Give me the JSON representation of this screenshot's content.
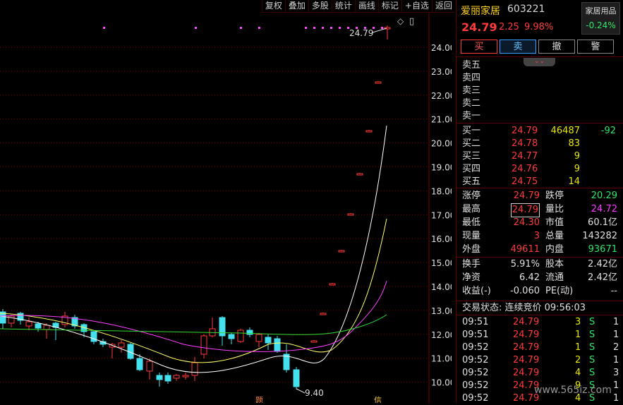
{
  "toolbar": [
    "复权",
    "叠加",
    "多股",
    "统计",
    "画线",
    "标记",
    "+自选",
    "返回"
  ],
  "chart": {
    "y_labels": [
      "24.00",
      "23.00",
      "22.00",
      "21.00",
      "20.00",
      "19.00",
      "18.00",
      "17.00",
      "16.00",
      "15.00",
      "14.00",
      "13.00",
      "12.00",
      "11.00",
      "10.00"
    ],
    "high_label": "24.79",
    "low_label": "9.40",
    "buttons": {
      "diamond": "◇",
      "square": "▯"
    }
  },
  "stock": {
    "name": "爱丽家居",
    "code": "603221",
    "price": "24.79",
    "change": "2.25",
    "pct": "9.98%"
  },
  "sector": {
    "name": "家居用品",
    "pct": "-0.24%"
  },
  "actions": {
    "buy": "买",
    "sell": "卖",
    "cancel": "撤",
    "alert": "警"
  },
  "asks": [
    "卖五",
    "卖四",
    "卖三",
    "卖二",
    "卖一"
  ],
  "bids": [
    {
      "label": "买一",
      "price": "24.79",
      "vol": "46487",
      "delta": "-92"
    },
    {
      "label": "买二",
      "price": "24.78",
      "vol": "83",
      "delta": ""
    },
    {
      "label": "买三",
      "price": "24.77",
      "vol": "9",
      "delta": ""
    },
    {
      "label": "买四",
      "price": "24.76",
      "vol": "9",
      "delta": ""
    },
    {
      "label": "买五",
      "price": "24.75",
      "vol": "14",
      "delta": ""
    }
  ],
  "stats": [
    {
      "l1": "涨停",
      "v1": "24.79",
      "l2": "跌停",
      "v2": "20.29"
    },
    {
      "l1": "最高",
      "v1": "24.79",
      "l2": "量比",
      "v2": "24.72"
    },
    {
      "l1": "最低",
      "v1": "24.30",
      "l2": "市值",
      "v2": "60.1亿"
    },
    {
      "l1": "现量",
      "v1": "3",
      "l2": "总量",
      "v2": "143282"
    },
    {
      "l1": "外盘",
      "v1": "49611",
      "l2": "内盘",
      "v2": "93671"
    }
  ],
  "fund": [
    {
      "l1": "换手",
      "v1": "5.91%",
      "l2": "股本",
      "v2": "2.42亿"
    },
    {
      "l1": "净资",
      "v1": "6.42",
      "l2": "流通",
      "v2": "2.42亿"
    },
    {
      "l1": "收益(-)",
      "v1": "-0.060",
      "l2": "PE(动)",
      "v2": "--"
    }
  ],
  "trade_status": "交易状态: 连续竞价 09:56:03",
  "ticks": [
    {
      "t": "09:51",
      "p": "24.79",
      "v": "3",
      "s": "S",
      "n": "1"
    },
    {
      "t": "09:51",
      "p": "24.79",
      "v": "1",
      "s": "S",
      "n": "1"
    },
    {
      "t": "09:52",
      "p": "24.79",
      "v": "1",
      "s": "S",
      "n": "2"
    },
    {
      "t": "09:52",
      "p": "24.79",
      "v": "2",
      "s": "S",
      "n": "1"
    },
    {
      "t": "09:52",
      "p": "24.79",
      "v": "4",
      "s": "S",
      "n": "3"
    },
    {
      "t": "09:52",
      "p": "24.79",
      "v": "9",
      "s": "S",
      "n": "1"
    },
    {
      "t": "09:52",
      "p": "24.79",
      "v": "4",
      "s": "S",
      "n": "1"
    }
  ],
  "watermark": "www.565iz.com",
  "markers": {
    "left": "题",
    "right": "信"
  },
  "colors": {
    "up": "#ff3b3b",
    "down": "#44e0ee",
    "ma1": "#ffffff",
    "ma2": "#ffff66",
    "ma3": "#ff40ff",
    "ma4": "#33dd33"
  }
}
